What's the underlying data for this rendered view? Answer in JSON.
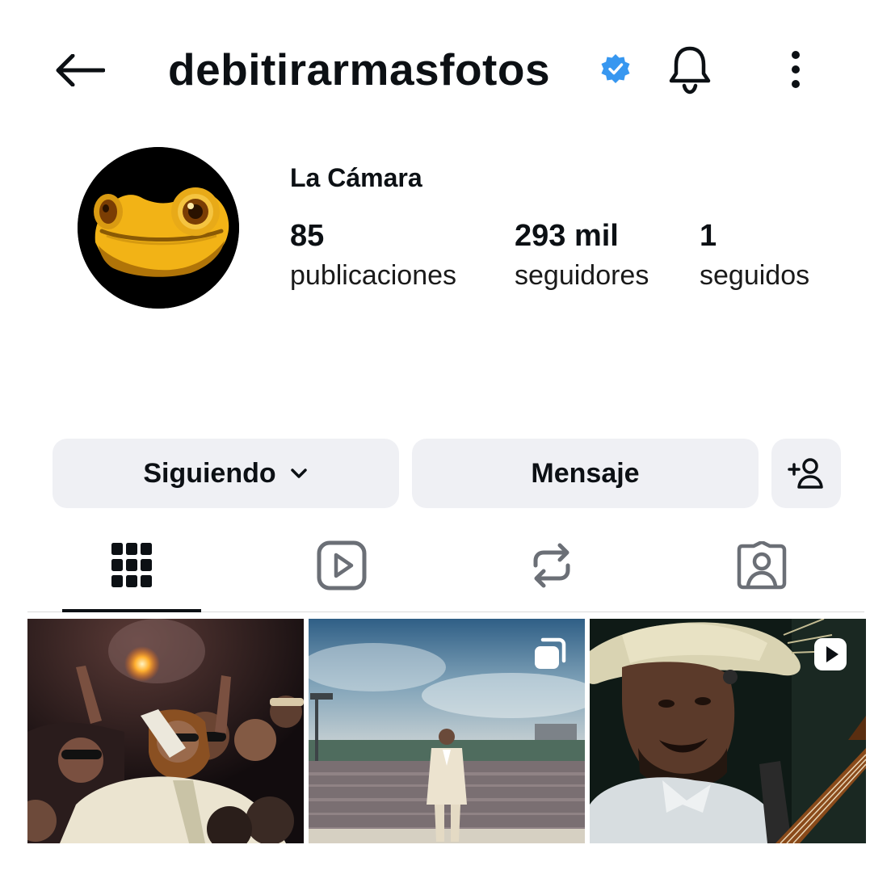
{
  "header": {
    "username": "debitirarmasfotos",
    "back_icon": "arrow-left-icon",
    "verified_icon": "verified-badge-icon",
    "bell_icon": "bell-icon",
    "more_icon": "more-vertical-icon"
  },
  "profile": {
    "display_name": "La Cámara",
    "avatar_icon": "frog-avatar",
    "stats": [
      {
        "value": "85",
        "label": "publicaciones"
      },
      {
        "value": "293 mil",
        "label": "seguidores"
      },
      {
        "value": "1",
        "label": "seguidos"
      }
    ]
  },
  "actions": {
    "following_label": "Siguiendo",
    "message_label": "Mensaje",
    "add_user_icon": "add-person-icon"
  },
  "tabs": [
    {
      "icon": "grid-icon",
      "selected": true
    },
    {
      "icon": "reels-icon",
      "selected": false
    },
    {
      "icon": "reposts-icon",
      "selected": false
    },
    {
      "icon": "tagged-icon",
      "selected": false
    }
  ],
  "posts": [
    {
      "type": "photo"
    },
    {
      "type": "carousel",
      "badge": "carousel-icon"
    },
    {
      "type": "reel",
      "badge": "reel-play-icon"
    }
  ],
  "colors": {
    "verified": "#3797f0",
    "button_bg": "#eff0f4",
    "text": "#0c1014",
    "avatar_frog": "#f2b316"
  }
}
